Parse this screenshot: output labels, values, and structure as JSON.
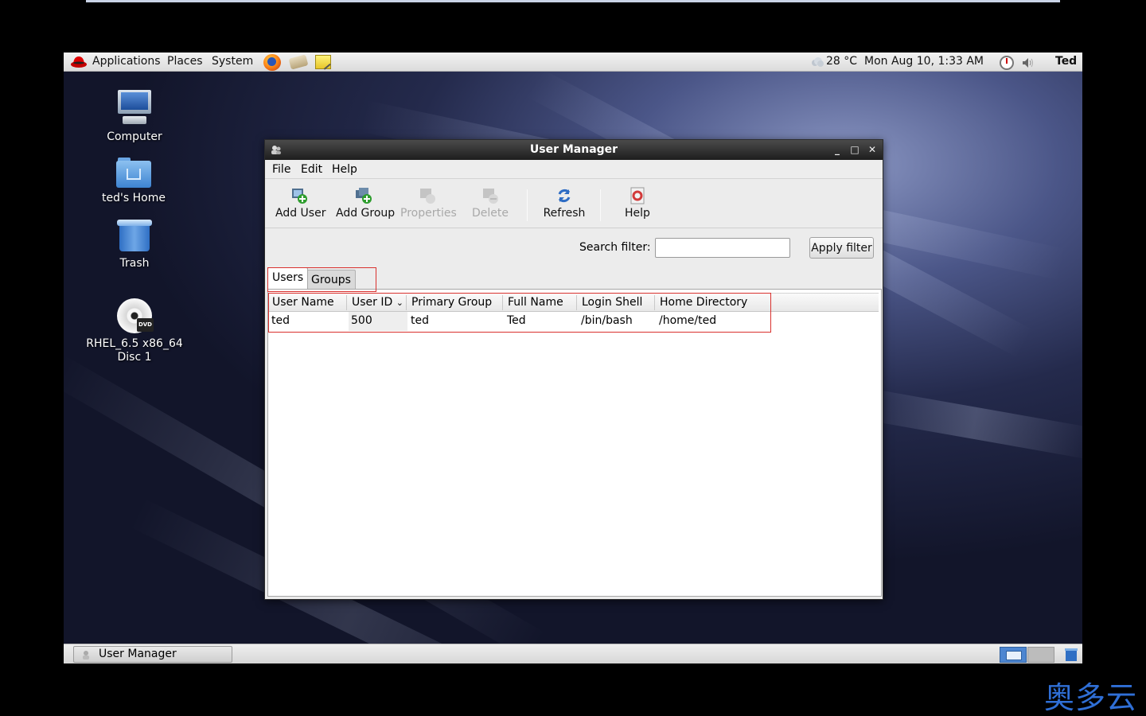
{
  "top_panel": {
    "menus": [
      "Applications",
      "Places",
      "System"
    ],
    "weather": "28 °C",
    "clock": "Mon Aug 10,  1:33 AM",
    "user": "Ted"
  },
  "desktop_icons": {
    "computer": "Computer",
    "home": "ted's Home",
    "trash": "Trash",
    "dvd_line1": "RHEL_6.5 x86_64",
    "dvd_line2": "Disc 1",
    "dvd_badge": "DVD"
  },
  "window": {
    "title": "User Manager",
    "menu": [
      "File",
      "Edit",
      "Help"
    ],
    "toolbar": {
      "add_user": "Add User",
      "add_group": "Add Group",
      "properties": "Properties",
      "delete": "Delete",
      "refresh": "Refresh",
      "help": "Help"
    },
    "search_label": "Search filter:",
    "search_value": "",
    "apply_label": "Apply filter",
    "tabs": [
      "Users",
      "Groups"
    ],
    "columns": [
      "User Name",
      "User ID",
      "Primary Group",
      "Full Name",
      "Login Shell",
      "Home Directory"
    ],
    "rows": [
      [
        "ted",
        "500",
        "ted",
        "Ted",
        "/bin/bash",
        "/home/ted"
      ]
    ]
  },
  "bottom_panel": {
    "task": "User Manager"
  },
  "watermark": "奥多云",
  "colors": {
    "highlight": "#d9312e",
    "accent": "#2f6fd6"
  }
}
